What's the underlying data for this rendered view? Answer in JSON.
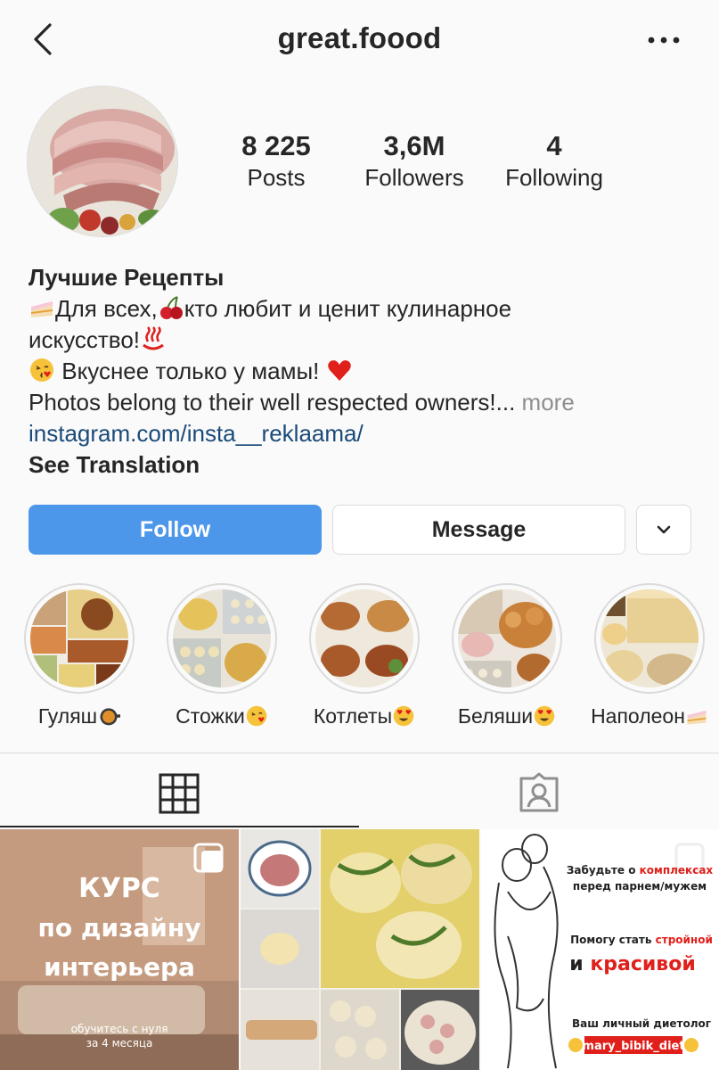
{
  "header": {
    "username": "great.foood",
    "back_icon": "chevron-left-icon",
    "more_icon": "more-dots-icon"
  },
  "stats": [
    {
      "value": "8 225",
      "label": "Posts"
    },
    {
      "value": "3,6M",
      "label": "Followers"
    },
    {
      "value": "4",
      "label": "Following"
    }
  ],
  "bio": {
    "name": "Лучшие Рецепты",
    "line1": "Для всех,",
    "line1b": "кто любит и ценит кулинарное",
    "line2": "искусство!",
    "line3": "Вкуснее только у мамы!",
    "line4": "Photos belong to their well respected owners!...",
    "more": "more",
    "link": "instagram.com/insta__reklaama/",
    "see_translation": "See Translation"
  },
  "actions": {
    "follow": "Follow",
    "message": "Message",
    "dropdown_icon": "chevron-down-icon"
  },
  "highlights": [
    {
      "label": "Гуляш"
    },
    {
      "label": "Стожки"
    },
    {
      "label": "Котлеты"
    },
    {
      "label": "Беляши"
    },
    {
      "label": "Наполеон"
    }
  ],
  "tabs": [
    {
      "name": "grid-icon",
      "active": true
    },
    {
      "name": "tagged-icon",
      "active": false
    }
  ],
  "posts": {
    "post1": {
      "title_line1": "КУРС",
      "title_line2": "по дизайну",
      "title_line3": "интерьера",
      "subtitle_line1": "обучитесь с нуля",
      "subtitle_line2": "за 4 месяца"
    },
    "post3": {
      "line1a": "Забудьте о",
      "line1b": "комплексах",
      "line2": "перед парнем/мужем",
      "line3a": "Помогу стать",
      "line3b": "стройной",
      "line4a": "и",
      "line4b": "красивой",
      "line5": "Ваш личный диетолог",
      "handle": "mary_bibik_diet"
    }
  },
  "colors": {
    "follow_blue": "#4d97eb",
    "link_blue": "#1b4a7a",
    "muted": "#8e8e8e",
    "border": "#dbdbdb",
    "promo_red": "#e0201b"
  }
}
